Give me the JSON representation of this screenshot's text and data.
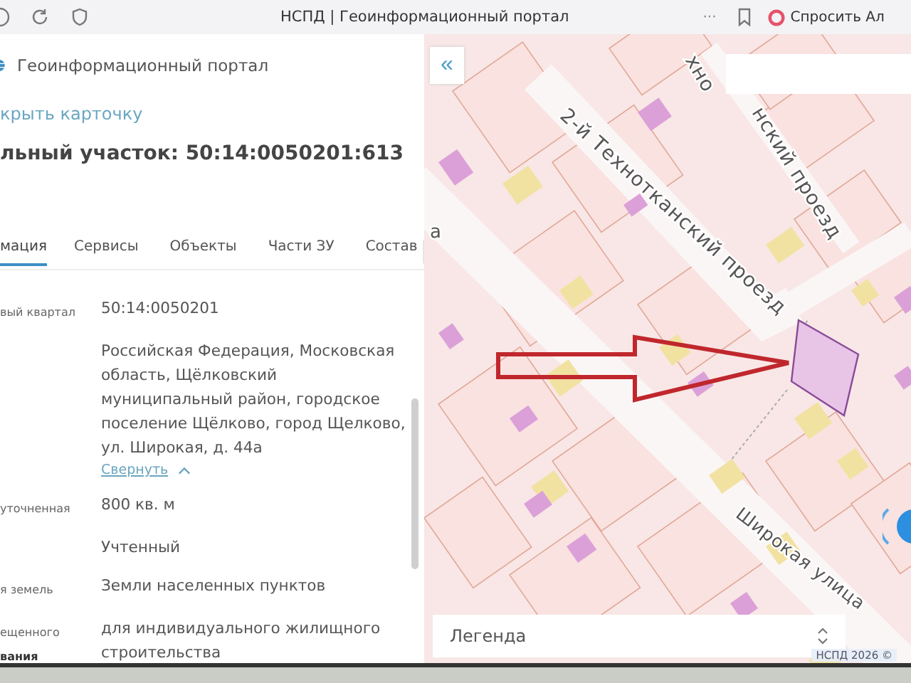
{
  "browser": {
    "title": "НСПД | Геоинформационный портал",
    "more": "···",
    "assistant": "Спросить Ал"
  },
  "panel": {
    "portal_name": "Геоинформационный портал",
    "close_link": "крыть карточку",
    "heading": "льный участок: 50:14:0050201:613",
    "tabs": [
      {
        "label": "мация",
        "selected": true
      },
      {
        "label": "Сервисы",
        "selected": false
      },
      {
        "label": "Объекты",
        "selected": false
      },
      {
        "label": "Части ЗУ",
        "selected": false
      },
      {
        "label": "Состав",
        "selected": false
      }
    ],
    "rows": [
      {
        "label": [
          "вый квартал"
        ],
        "value": "50:14:0050201"
      },
      {
        "value": "Российская Федерация, Московская область, Щёлковский муниципальный район, городское поселение Щёлково, город Щелково, ул. Широкая, д. 44а",
        "toggle": "Свернуть"
      },
      {
        "label": [
          "уточненная"
        ],
        "value": "800 кв. м"
      },
      {
        "value": "Учтенный"
      },
      {
        "label": [
          "я земель"
        ],
        "value": "Земли населенных пунктов"
      },
      {
        "label": [
          "ещенного",
          "вания"
        ],
        "value": "для индивидуального жилищного строительства"
      }
    ]
  },
  "map": {
    "collapse": "«",
    "streets": [
      "2-й Технотканский проезд",
      "хно",
      "нский проезд",
      "Широкая улица",
      "а"
    ],
    "legend": "Легенда",
    "copyright": "НСПД 2026 ©"
  }
}
